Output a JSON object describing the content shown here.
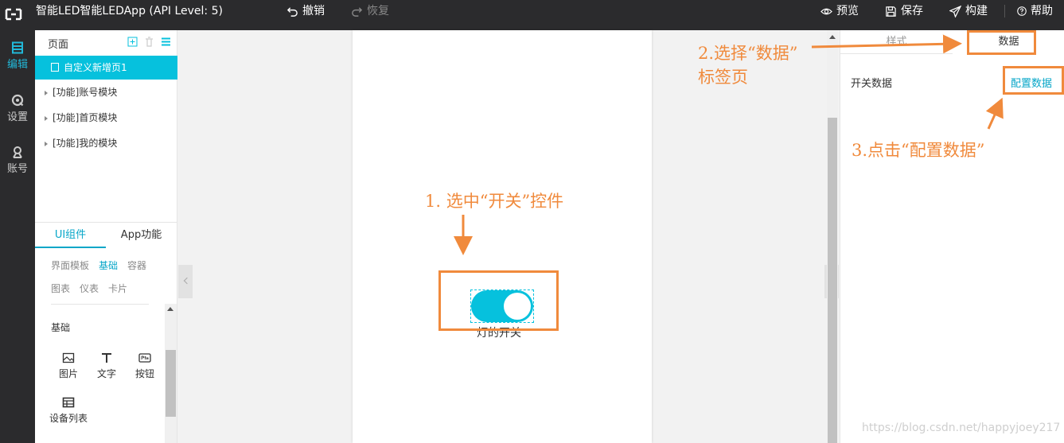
{
  "app": {
    "title": "智能LED智能LEDApp (API Level: 5)"
  },
  "toolbar": {
    "undo": "撤销",
    "redo": "恢复",
    "preview": "预览",
    "save": "保存",
    "build": "构建",
    "help": "帮助"
  },
  "rail": {
    "items": [
      {
        "label": "编辑"
      },
      {
        "label": "设置"
      },
      {
        "label": "账号"
      }
    ]
  },
  "pages": {
    "title": "页面",
    "items": [
      {
        "label": "自定义新增页1"
      },
      {
        "label": "[功能]账号模块"
      },
      {
        "label": "[功能]首页模块"
      },
      {
        "label": "[功能]我的模块"
      }
    ]
  },
  "component_tabs": {
    "ui": "UI组件",
    "app": "App功能"
  },
  "categories": [
    "界面模板",
    "基础",
    "容器",
    "图表",
    "仪表",
    "卡片"
  ],
  "section": {
    "title": "基础"
  },
  "widgets": [
    {
      "label": "图片"
    },
    {
      "label": "文字"
    },
    {
      "label": "按钮"
    },
    {
      "label": "设备列表"
    }
  ],
  "canvas": {
    "switch_label": "灯的开关",
    "switch_on": true
  },
  "right_panel": {
    "tab_style": "样式",
    "tab_data": "数据",
    "data_label": "开关数据",
    "config_link": "配置数据"
  },
  "annotations": {
    "step1": "1. 选中“开关”控件",
    "step2_line1": "2.选择“数据”",
    "step2_line2": "标签页",
    "step3": "3.点击“配置数据”"
  },
  "watermark": "https://blog.csdn.net/happyjoey217",
  "colors": {
    "accent": "#06c1dd",
    "annotation": "#f08a3c",
    "topbar": "#2b2b2d"
  }
}
